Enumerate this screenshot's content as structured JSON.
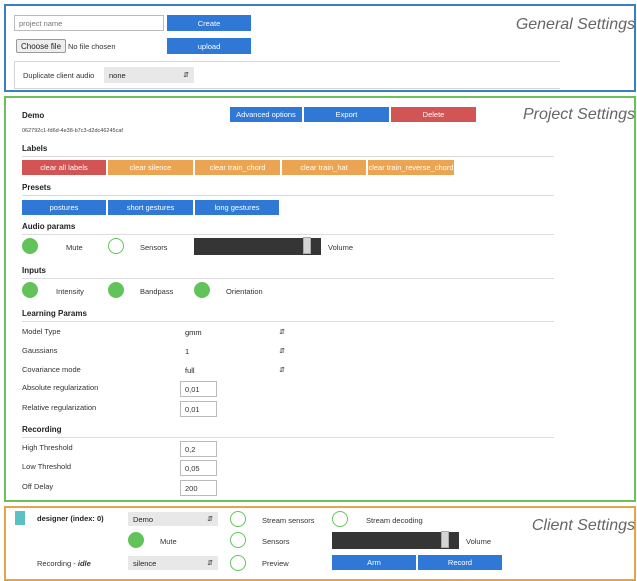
{
  "general": {
    "title": "General Settings",
    "project_name_placeholder": "project name",
    "create_label": "Create",
    "choose_file_label": "Choose file",
    "no_file_text": "No file chosen",
    "upload_label": "upload",
    "duplicate_label": "Duplicate client audio",
    "duplicate_value": "none"
  },
  "project": {
    "title": "Project Settings",
    "name": "Demo",
    "id": "062792c1-fd6d-4e38-b7c3-d2dc46245caf",
    "advanced_label": "Advanced options",
    "export_label": "Export",
    "delete_label": "Delete",
    "labels_heading": "Labels",
    "label_buttons": [
      "clear all labels",
      "clear silence",
      "clear train_chord",
      "clear train_hat",
      "clear train_reverse_chord"
    ],
    "presets_heading": "Presets",
    "preset_buttons": [
      "postures",
      "short gestures",
      "long gestures"
    ],
    "audio_heading": "Audio params",
    "mute_label": "Mute",
    "sensors_label": "Sensors",
    "volume_label": "Volume",
    "volume_level": 0.92,
    "inputs_heading": "Inputs",
    "intensity_label": "Intensity",
    "bandpass_label": "Bandpass",
    "orientation_label": "Orientation",
    "learning_heading": "Learning Params",
    "model_type_label": "Model Type",
    "model_type_value": "gmm",
    "gaussians_label": "Gaussians",
    "gaussians_value": "1",
    "covariance_label": "Covariance mode",
    "covariance_value": "full",
    "abs_reg_label": "Absolute regularization",
    "abs_reg_value": "0,01",
    "rel_reg_label": "Relative regularization",
    "rel_reg_value": "0,01",
    "recording_heading": "Recording",
    "high_label": "High Threshold",
    "high_value": "0,2",
    "low_label": "Low Threshold",
    "low_value": "0,05",
    "delay_label": "Off Delay",
    "delay_value": "200"
  },
  "client": {
    "title": "Client Settings",
    "designer_label": "designer (index: 0)",
    "project_value": "Demo",
    "stream_sensors_label": "Stream sensors",
    "stream_decoding_label": "Stream decoding",
    "mute_label": "Mute",
    "sensors_label": "Sensors",
    "volume_label": "Volume",
    "volume_level": 0.92,
    "recording_label": "Recording - ",
    "recording_state": "idle",
    "label_value": "silence",
    "preview_label": "Preview",
    "arm_label": "Arm",
    "record_label": "Record"
  },
  "colors": {
    "general_border": "#3a7fc6",
    "project_border": "#69c15a",
    "client_border": "#e9a24a",
    "primary": "#2f78d6",
    "danger": "#d25454",
    "warning": "#eba451",
    "toggle": "#62c35a"
  }
}
